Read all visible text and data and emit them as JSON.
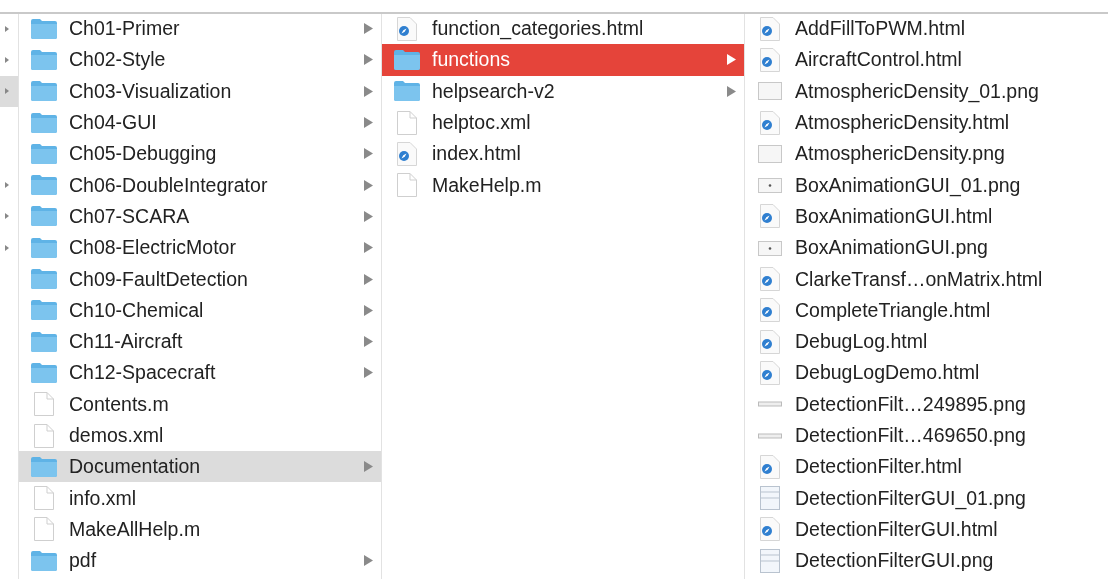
{
  "edge_rows": [
    {
      "arrow": true,
      "selected": false
    },
    {
      "arrow": true,
      "selected": false
    },
    {
      "arrow": true,
      "selected": true
    },
    {
      "arrow": false,
      "selected": false
    },
    {
      "arrow": false,
      "selected": false
    },
    {
      "arrow": true,
      "selected": false
    },
    {
      "arrow": true,
      "selected": false
    },
    {
      "arrow": true,
      "selected": false
    }
  ],
  "columns": [
    {
      "items": [
        {
          "name": "Ch01-Primer",
          "kind": "folder",
          "has_children": true,
          "selected": false
        },
        {
          "name": "Ch02-Style",
          "kind": "folder",
          "has_children": true,
          "selected": false
        },
        {
          "name": "Ch03-Visualization",
          "kind": "folder",
          "has_children": true,
          "selected": false
        },
        {
          "name": "Ch04-GUI",
          "kind": "folder",
          "has_children": true,
          "selected": false
        },
        {
          "name": "Ch05-Debugging",
          "kind": "folder",
          "has_children": true,
          "selected": false
        },
        {
          "name": "Ch06-DoubleIntegrator",
          "kind": "folder",
          "has_children": true,
          "selected": false
        },
        {
          "name": "Ch07-SCARA",
          "kind": "folder",
          "has_children": true,
          "selected": false
        },
        {
          "name": "Ch08-ElectricMotor",
          "kind": "folder",
          "has_children": true,
          "selected": false
        },
        {
          "name": "Ch09-FaultDetection",
          "kind": "folder",
          "has_children": true,
          "selected": false
        },
        {
          "name": "Ch10-Chemical",
          "kind": "folder",
          "has_children": true,
          "selected": false
        },
        {
          "name": "Ch11-Aircraft",
          "kind": "folder",
          "has_children": true,
          "selected": false
        },
        {
          "name": "Ch12-Spacecraft",
          "kind": "folder",
          "has_children": true,
          "selected": false
        },
        {
          "name": "Contents.m",
          "kind": "document",
          "has_children": false,
          "selected": false
        },
        {
          "name": "demos.xml",
          "kind": "document",
          "has_children": false,
          "selected": false
        },
        {
          "name": "Documentation",
          "kind": "folder",
          "has_children": true,
          "selected": true,
          "focused": false
        },
        {
          "name": "info.xml",
          "kind": "document",
          "has_children": false,
          "selected": false
        },
        {
          "name": "MakeAllHelp.m",
          "kind": "document",
          "has_children": false,
          "selected": false
        },
        {
          "name": "pdf",
          "kind": "folder",
          "has_children": true,
          "selected": false
        }
      ]
    },
    {
      "items": [
        {
          "name": "function_categories.html",
          "kind": "html",
          "has_children": false,
          "selected": false
        },
        {
          "name": "functions",
          "kind": "folder",
          "has_children": true,
          "selected": true,
          "focused": true
        },
        {
          "name": "helpsearch-v2",
          "kind": "folder",
          "has_children": true,
          "selected": false
        },
        {
          "name": "helptoc.xml",
          "kind": "document",
          "has_children": false,
          "selected": false
        },
        {
          "name": "index.html",
          "kind": "html",
          "has_children": false,
          "selected": false
        },
        {
          "name": "MakeHelp.m",
          "kind": "document",
          "has_children": false,
          "selected": false
        }
      ]
    },
    {
      "items": [
        {
          "name": "AddFillToPWM.html",
          "kind": "html",
          "has_children": false,
          "selected": false
        },
        {
          "name": "AircraftControl.html",
          "kind": "html",
          "has_children": false,
          "selected": false
        },
        {
          "name": "AtmosphericDensity_01.png",
          "kind": "image",
          "has_children": false,
          "selected": false
        },
        {
          "name": "AtmosphericDensity.html",
          "kind": "html",
          "has_children": false,
          "selected": false
        },
        {
          "name": "AtmosphericDensity.png",
          "kind": "image",
          "has_children": false,
          "selected": false
        },
        {
          "name": "BoxAnimationGUI_01.png",
          "kind": "image-dot",
          "has_children": false,
          "selected": false
        },
        {
          "name": "BoxAnimationGUI.html",
          "kind": "html",
          "has_children": false,
          "selected": false
        },
        {
          "name": "BoxAnimationGUI.png",
          "kind": "image-dot",
          "has_children": false,
          "selected": false
        },
        {
          "name": "ClarkeTransf…onMatrix.html",
          "kind": "html",
          "has_children": false,
          "selected": false
        },
        {
          "name": "CompleteTriangle.html",
          "kind": "html",
          "has_children": false,
          "selected": false
        },
        {
          "name": "DebugLog.html",
          "kind": "html",
          "has_children": false,
          "selected": false
        },
        {
          "name": "DebugLogDemo.html",
          "kind": "html",
          "has_children": false,
          "selected": false
        },
        {
          "name": "DetectionFilt…249895.png",
          "kind": "image-strip",
          "has_children": false,
          "selected": false
        },
        {
          "name": "DetectionFilt…469650.png",
          "kind": "image-strip",
          "has_children": false,
          "selected": false
        },
        {
          "name": "DetectionFilter.html",
          "kind": "html",
          "has_children": false,
          "selected": false
        },
        {
          "name": "DetectionFilterGUI_01.png",
          "kind": "image-window",
          "has_children": false,
          "selected": false
        },
        {
          "name": "DetectionFilterGUI.html",
          "kind": "html",
          "has_children": false,
          "selected": false
        },
        {
          "name": "DetectionFilterGUI.png",
          "kind": "image-window",
          "has_children": false,
          "selected": false
        }
      ]
    }
  ]
}
